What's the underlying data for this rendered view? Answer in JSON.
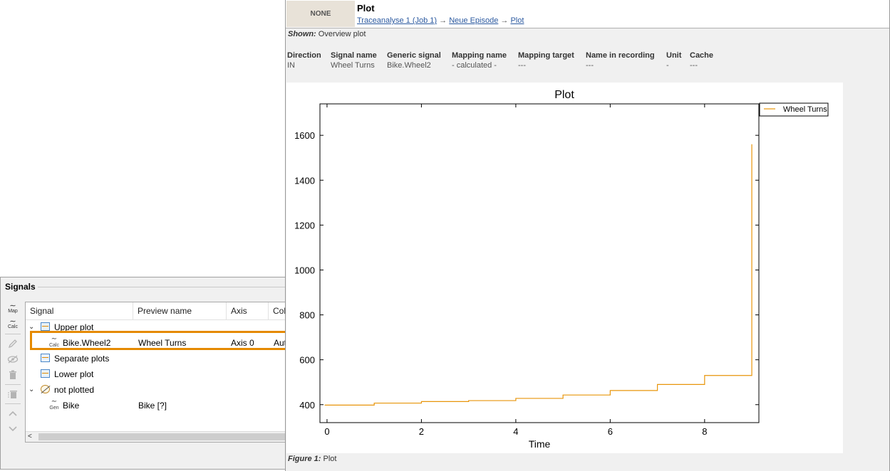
{
  "signals_panel": {
    "title": "Signals",
    "toolbar": [
      {
        "name": "map",
        "sub": "Map",
        "enabled": true
      },
      {
        "name": "calc",
        "sub": "Calc",
        "enabled": true
      },
      {
        "name": "edit",
        "enabled": false
      },
      {
        "name": "hide",
        "enabled": false
      },
      {
        "name": "delete",
        "enabled": false
      },
      {
        "name": "delete-all",
        "enabled": false
      },
      {
        "name": "move-up",
        "enabled": false
      },
      {
        "name": "move-down",
        "enabled": false
      }
    ],
    "columns": [
      "Signal",
      "Preview name",
      "Axis",
      "Col"
    ],
    "rows": [
      {
        "label": "Upper plot",
        "type": "group",
        "icon": "plot-group-icon"
      },
      {
        "label": "Bike.Wheel2",
        "badge": "Calc",
        "preview": "Wheel Turns",
        "axis": "Axis 0",
        "col": "Aut"
      },
      {
        "label": "Separate plots",
        "type": "group",
        "icon": "plot-group-icon"
      },
      {
        "label": "Lower plot",
        "type": "group",
        "icon": "plot-group-icon"
      },
      {
        "label": "not plotted",
        "type": "group",
        "icon": "not-plotted-icon"
      },
      {
        "label": "Bike",
        "badge": "Gen",
        "preview": "Bike [?]"
      }
    ]
  },
  "report": {
    "badge": "NONE",
    "title": "Plot",
    "breadcrumb": [
      "Traceanalyse 1 (Job 1)",
      "Neue Episode",
      "Plot"
    ],
    "breadcrumb_sep": "→",
    "shown_label": "Shown:",
    "shown_value": "Overview plot",
    "signal_table": {
      "headers": [
        "Direction",
        "Signal name",
        "Generic signal",
        "Mapping name",
        "Mapping target",
        "Name in recording",
        "Unit",
        "Cache"
      ],
      "values": [
        "IN",
        "Wheel Turns",
        "Bike.Wheel2",
        "- calculated -",
        "---",
        "---",
        "-",
        "---"
      ]
    },
    "figure_label": "Figure 1:",
    "figure_caption": "Plot"
  },
  "chart_data": {
    "type": "line",
    "title": "Plot",
    "xlabel": "Time",
    "ylabel": "",
    "xlim": [
      -0.15,
      9.15
    ],
    "ylim": [
      320,
      1740
    ],
    "xticks": [
      0,
      2,
      4,
      6,
      8
    ],
    "yticks": [
      400,
      600,
      800,
      1000,
      1200,
      1400,
      1600
    ],
    "legend_position": "outside-top-right",
    "colors": {
      "series": "#e8950a"
    },
    "series": [
      {
        "name": "Wheel Turns",
        "step": true,
        "x": [
          -0.05,
          1,
          2,
          3,
          4,
          5,
          6,
          7,
          8,
          9,
          9
        ],
        "y": [
          398,
          407,
          414,
          418,
          428,
          443,
          463,
          490,
          530,
          530,
          1560
        ]
      }
    ]
  }
}
